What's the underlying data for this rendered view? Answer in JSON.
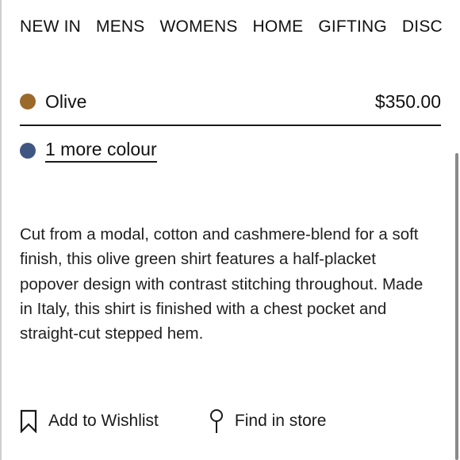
{
  "nav": {
    "items": [
      "NEW IN",
      "MENS",
      "WOMENS",
      "HOME",
      "GIFTING",
      "DISC"
    ]
  },
  "colour": {
    "selected_name": "Olive",
    "selected_swatch": "#9a6a2b",
    "price": "$350.00",
    "more_label": "1 more colour",
    "more_swatch": "#3f5683"
  },
  "description": "Cut from a modal, cotton and cashmere-blend for a soft finish, this olive green shirt features a half-placket popover design with contrast stitching throughout. Made in Italy, this shirt is finished with a chest pocket and straight-cut stepped hem.",
  "actions": {
    "wishlist_label": "Add to Wishlist",
    "wishlist_icon": "bookmark-icon",
    "store_label": "Find in store",
    "store_icon": "location-pin-icon"
  }
}
